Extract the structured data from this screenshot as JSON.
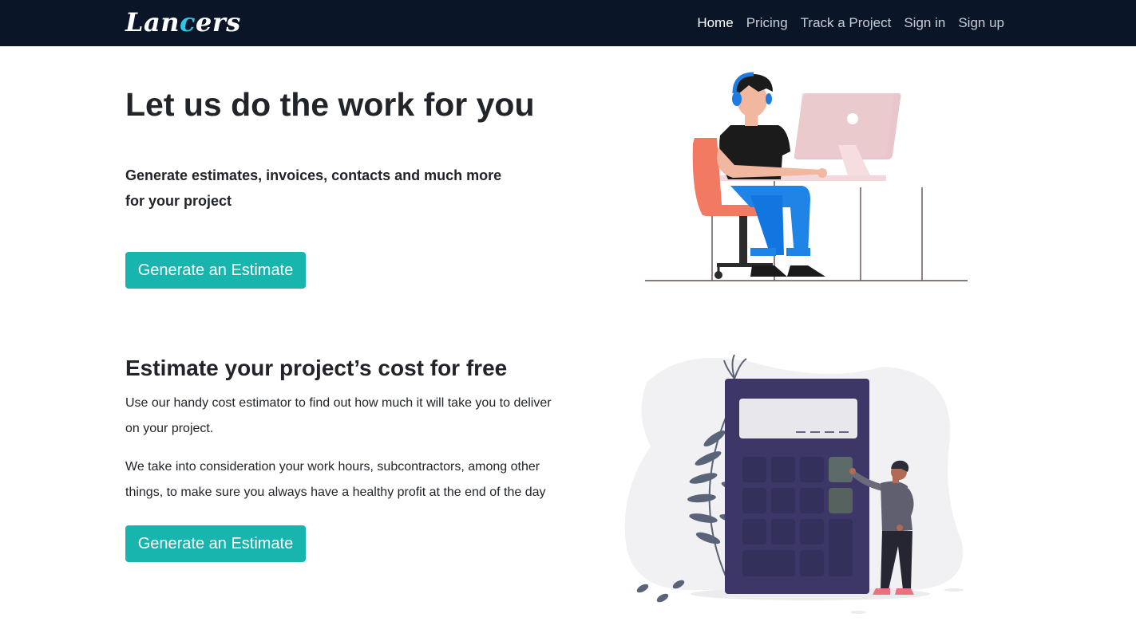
{
  "nav": {
    "brand_prefix": "Lan",
    "brand_accent": "c",
    "brand_suffix": "ers",
    "links": [
      "Home",
      "Pricing",
      "Track a Project",
      "Sign in",
      "Sign up"
    ]
  },
  "hero": {
    "title": "Let us do the work for you",
    "subtitle": "Generate estimates, invoices, contacts and much more for your project",
    "button_label": "Generate an Estimate",
    "illustration_icon": "developer-at-desk-illustration"
  },
  "estimate": {
    "title": "Estimate your project’s cost for free",
    "paragraph_1": "Use our handy cost estimator to find out how much it will take you to deliver on your project.",
    "paragraph_2": "We take into consideration your work hours, subcontractors, among other things, to make sure you always have a healthy profit at the end of the day",
    "button_label": "Generate an Estimate",
    "illustration_icon": "calculator-illustration"
  },
  "colors": {
    "navbar_bg": "#0b1528",
    "brand_accent": "#2ec7e6",
    "button_bg": "#17b5ad",
    "text": "#212529"
  }
}
